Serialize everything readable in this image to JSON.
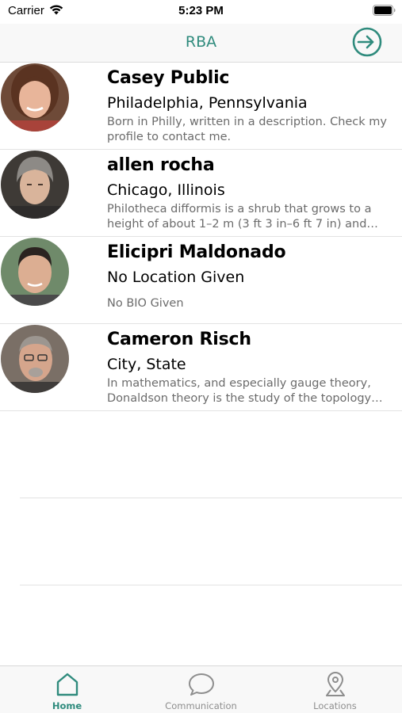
{
  "status_bar": {
    "carrier": "Carrier",
    "time": "5:23 PM"
  },
  "nav": {
    "title": "RBA",
    "action_icon": "sign-in-icon",
    "accent_color": "#2f8b7d"
  },
  "people": [
    {
      "name": "Casey Public",
      "location": "Philadelphia, Pennsylvania",
      "bio": "Born in Philly, written in a description. Check my profile to contact me."
    },
    {
      "name": "allen rocha",
      "location": "Chicago, Illinois",
      "bio": "Philotheca difformis is a shrub that grows to a height of about 1–2 m (3 ft 3 in–6 ft 7 in) and ha..."
    },
    {
      "name": "Elicipri Maldonado",
      "location": "No Location Given",
      "bio": "No BIO Given"
    },
    {
      "name": "Cameron Risch",
      "location": "City, State",
      "bio": "In mathematics, and especially gauge theory, Donaldson theory is the study of the topology of..."
    }
  ],
  "tabs": [
    {
      "label": "Home",
      "icon": "home-icon",
      "active": true
    },
    {
      "label": "Communication",
      "icon": "chat-bubble-icon",
      "active": false
    },
    {
      "label": "Locations",
      "icon": "map-pin-icon",
      "active": false
    }
  ]
}
